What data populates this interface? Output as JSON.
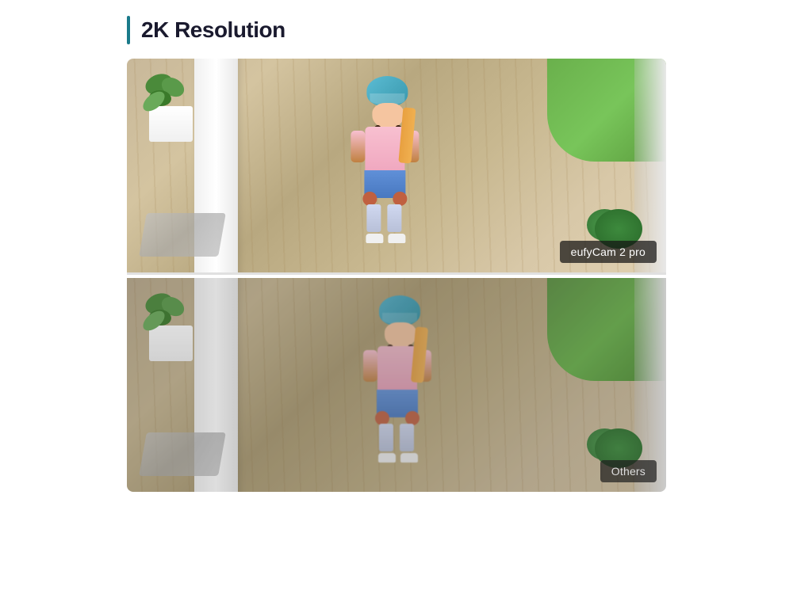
{
  "page": {
    "background_color": "#ffffff"
  },
  "header": {
    "accent_color": "#1a7a8a",
    "title": "2K Resolution"
  },
  "top_image": {
    "label": "eufyCam 2 pro",
    "quality": "high",
    "description": "High quality 2K camera view of child on porch with skateboard"
  },
  "bottom_image": {
    "label": "Others",
    "quality": "lower",
    "description": "Lower quality camera view of same scene for comparison"
  },
  "icons": {
    "header_bar": "vertical-accent-bar"
  }
}
